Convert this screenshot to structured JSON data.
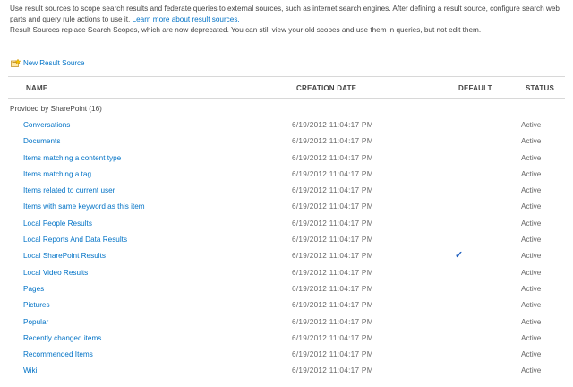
{
  "intro": {
    "line1": "Use result sources to scope search results and federate queries to external sources, such as internet search engines. After defining a result source, configure search web",
    "line2": "parts and query rule actions to use it.",
    "learn_more": "Learn more about result sources.",
    "line3": "Result Sources replace Search Scopes, which are now deprecated. You can still view your old scopes and use them in queries, but not edit them."
  },
  "toolbar": {
    "new_label": "New Result Source",
    "new_icon": "new-item-icon"
  },
  "columns": {
    "name": "NAME",
    "creation_date": "CREATION DATE",
    "default": "DEFAULT",
    "status": "STATUS"
  },
  "group_label": "Provided by SharePoint (16)",
  "default_mark": "✓",
  "rows": [
    {
      "name": "Conversations",
      "date": "6/19/2012 11:04:17 PM",
      "default": false,
      "status": "Active"
    },
    {
      "name": "Documents",
      "date": "6/19/2012 11:04:17 PM",
      "default": false,
      "status": "Active"
    },
    {
      "name": "Items matching a content type",
      "date": "6/19/2012 11:04:17 PM",
      "default": false,
      "status": "Active"
    },
    {
      "name": "Items matching a tag",
      "date": "6/19/2012 11:04:17 PM",
      "default": false,
      "status": "Active"
    },
    {
      "name": "Items related to current user",
      "date": "6/19/2012 11:04:17 PM",
      "default": false,
      "status": "Active"
    },
    {
      "name": "Items with same keyword as this item",
      "date": "6/19/2012 11:04:17 PM",
      "default": false,
      "status": "Active"
    },
    {
      "name": "Local People Results",
      "date": "6/19/2012 11:04:17 PM",
      "default": false,
      "status": "Active"
    },
    {
      "name": "Local Reports And Data Results",
      "date": "6/19/2012 11:04:17 PM",
      "default": false,
      "status": "Active"
    },
    {
      "name": "Local SharePoint Results",
      "date": "6/19/2012 11:04:17 PM",
      "default": true,
      "status": "Active"
    },
    {
      "name": "Local Video Results",
      "date": "6/19/2012 11:04:17 PM",
      "default": false,
      "status": "Active"
    },
    {
      "name": "Pages",
      "date": "6/19/2012 11:04:17 PM",
      "default": false,
      "status": "Active"
    },
    {
      "name": "Pictures",
      "date": "6/19/2012 11:04:17 PM",
      "default": false,
      "status": "Active"
    },
    {
      "name": "Popular",
      "date": "6/19/2012 11:04:17 PM",
      "default": false,
      "status": "Active"
    },
    {
      "name": "Recently changed items",
      "date": "6/19/2012 11:04:17 PM",
      "default": false,
      "status": "Active"
    },
    {
      "name": "Recommended Items",
      "date": "6/19/2012 11:04:17 PM",
      "default": false,
      "status": "Active"
    },
    {
      "name": "Wiki",
      "date": "6/19/2012 11:04:17 PM",
      "default": false,
      "status": "Active"
    }
  ]
}
